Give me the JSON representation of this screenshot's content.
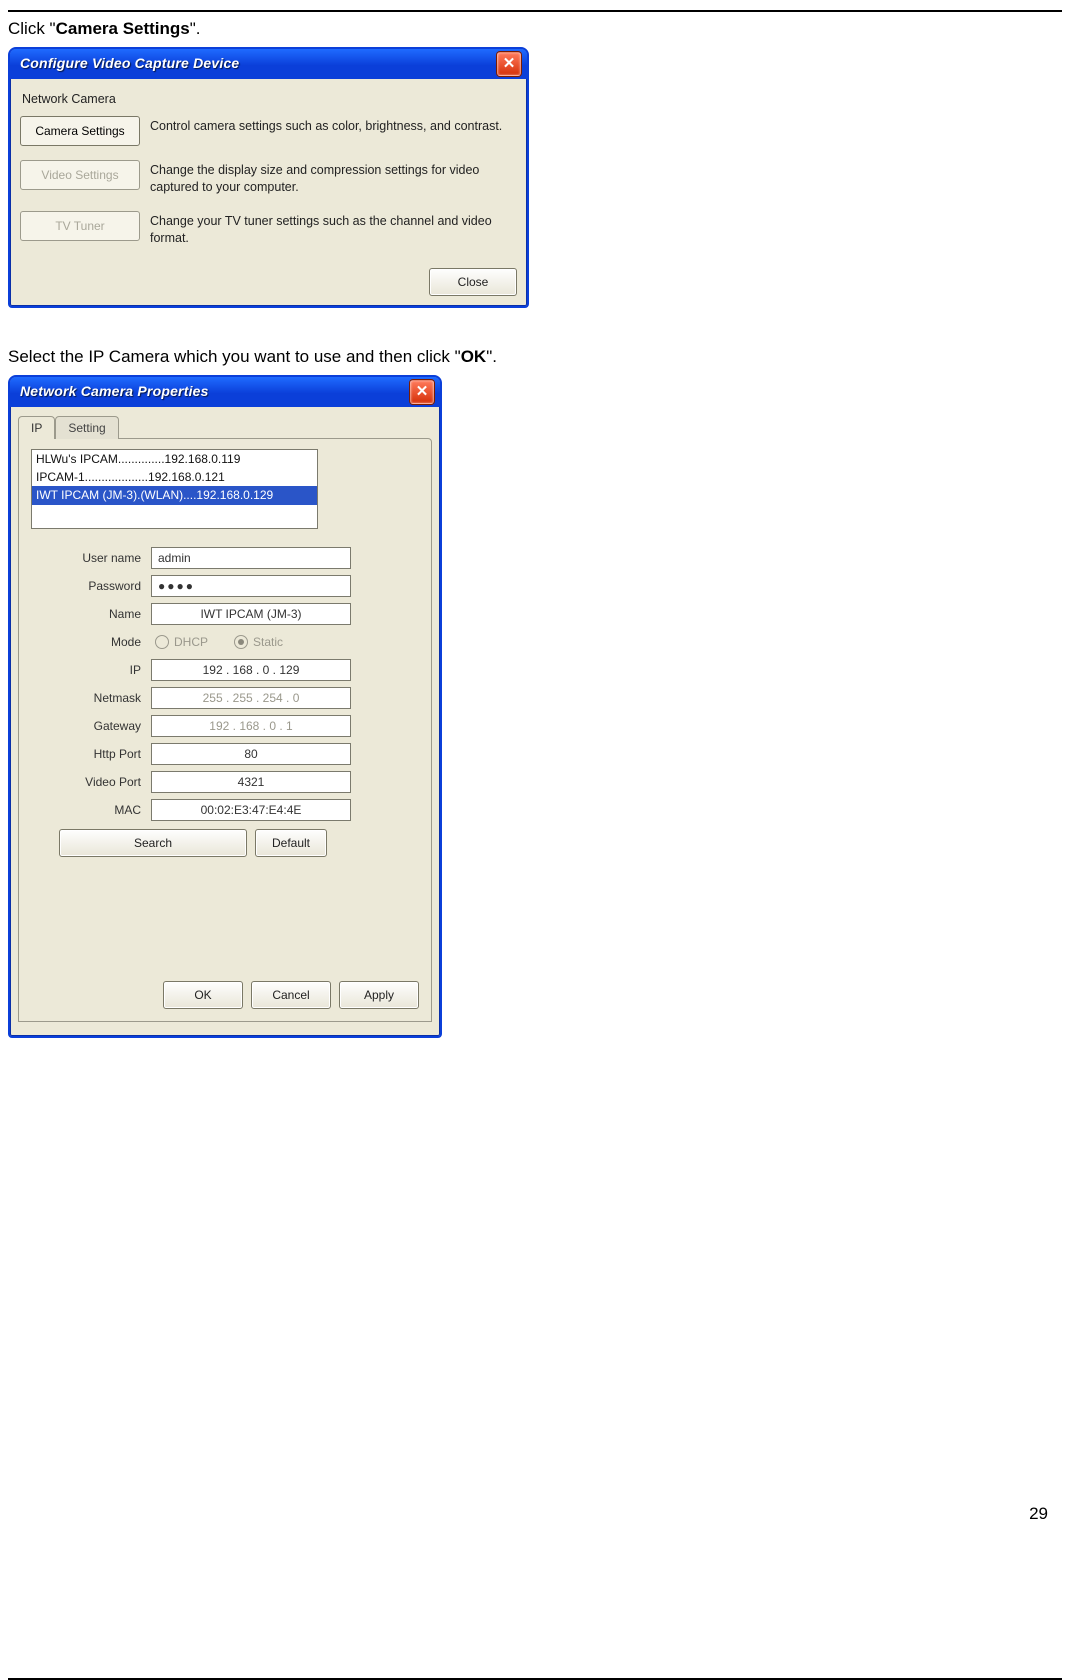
{
  "page_number": "29",
  "caption1": {
    "pre": "Click \"",
    "b": "Camera Settings",
    "post": "\"."
  },
  "caption2": {
    "pre": "Select the IP Camera which you want to use and then click \"",
    "b": "OK",
    "post": "\"."
  },
  "dlg1": {
    "title": "Configure Video Capture Device",
    "section": "Network Camera",
    "rows": [
      {
        "button": "Camera Settings",
        "enabled": true,
        "desc": "Control camera settings such as color, brightness, and contrast."
      },
      {
        "button": "Video Settings",
        "enabled": false,
        "desc": "Change the display size and compression settings for video captured to your computer."
      },
      {
        "button": "TV Tuner",
        "enabled": false,
        "desc": "Change your TV tuner settings such as the channel and video format."
      }
    ],
    "close": "Close"
  },
  "dlg2": {
    "title": "Network Camera Properties",
    "tabs": [
      "IP",
      "Setting"
    ],
    "list": [
      "HLWu's IPCAM..............192.168.0.119",
      "IPCAM-1...................192.168.0.121",
      "IWT IPCAM (JM-3).(WLAN)....192.168.0.129"
    ],
    "selected_index": 2,
    "fields": {
      "username_label": "User name",
      "username": "admin",
      "password_label": "Password",
      "password": "●●●●",
      "name_label": "Name",
      "name": "IWT IPCAM (JM-3)",
      "mode_label": "Mode",
      "mode_dhcp": "DHCP",
      "mode_static": "Static",
      "ip_label": "IP",
      "ip": "192  .  168  .    0    .  129",
      "netmask_label": "Netmask",
      "netmask": "255  .  255  .  254  .    0",
      "gateway_label": "Gateway",
      "gateway": "192  .  168  .    0    .    1",
      "http_label": "Http Port",
      "http": "80",
      "video_label": "Video Port",
      "video": "4321",
      "mac_label": "MAC",
      "mac": "00:02:E3:47:E4:4E"
    },
    "buttons": {
      "search": "Search",
      "default": "Default",
      "ok": "OK",
      "cancel": "Cancel",
      "apply": "Apply"
    }
  }
}
